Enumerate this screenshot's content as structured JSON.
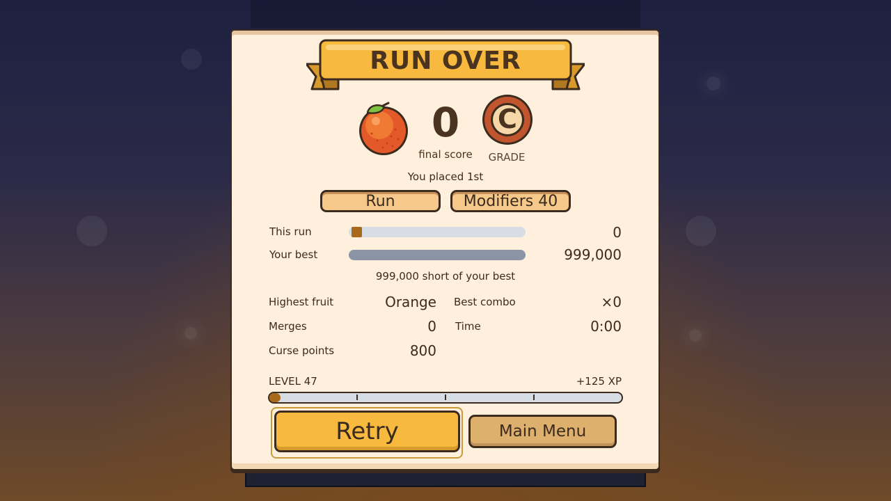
{
  "title": "RUN OVER",
  "score": {
    "value": "0",
    "caption": "final score"
  },
  "fruit_icon": "orange-icon",
  "grade": {
    "letter": "C",
    "caption": "GRADE"
  },
  "placement": "You placed 1st",
  "tabs": [
    {
      "label": "Run",
      "active": true
    },
    {
      "label": "Modifiers  40",
      "active": false
    }
  ],
  "comparison": {
    "this_run": {
      "label": "This run",
      "value": "0",
      "progress": 0.0
    },
    "your_best": {
      "label": "Your best",
      "value": "999,000",
      "progress": 1.0
    },
    "short_text": "999,000 short of your best"
  },
  "stats": {
    "highest_fruit": {
      "label": "Highest fruit",
      "value": "Orange"
    },
    "best_combo": {
      "label": "Best combo",
      "value": "×0"
    },
    "merges": {
      "label": "Merges",
      "value": "0"
    },
    "time": {
      "label": "Time",
      "value": "0:00"
    },
    "curse_points": {
      "label": "Curse points",
      "value": "800"
    }
  },
  "level": {
    "label": "LEVEL 47",
    "xp_gain": "+125 XP",
    "progress": 0.02
  },
  "buttons": {
    "retry": "Retry",
    "main_menu": "Main Menu"
  },
  "colors": {
    "panel": "#fef0dc",
    "accent": "#f7b93e",
    "text": "#3b2a1e",
    "progress_fill": "#a86a1a"
  }
}
